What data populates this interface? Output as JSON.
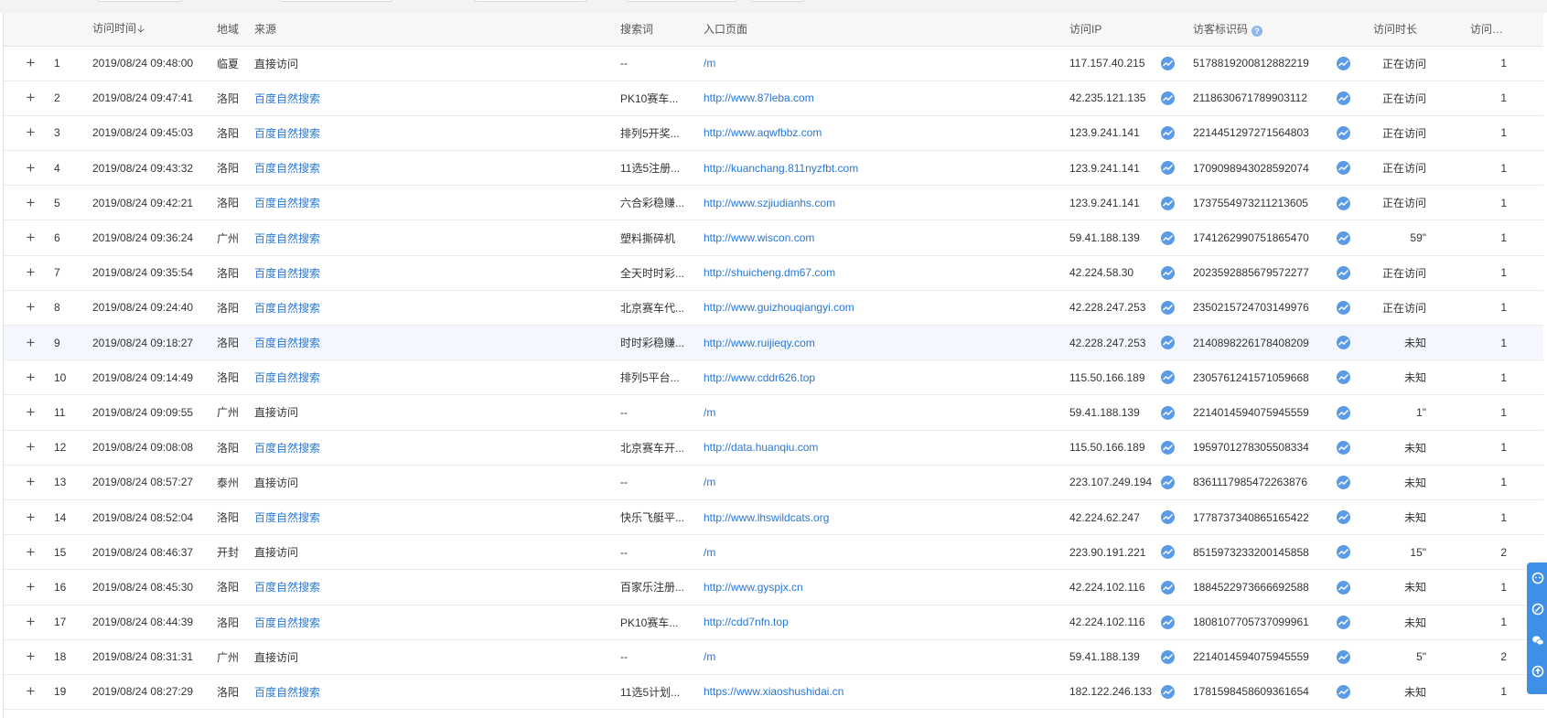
{
  "columns": {
    "visit_time": "访问时间",
    "region": "地域",
    "source": "来源",
    "keyword": "搜索词",
    "entry_page": "入口页面",
    "ip": "访问IP",
    "visitor_id": "访客标识码",
    "duration": "访问时长",
    "pages": "访问页数"
  },
  "icons": {
    "sort": "sort-down-arrow-icon",
    "help": "help-icon",
    "trend": "trend-chart-icon",
    "expand": "plus-icon"
  },
  "colors": {
    "link": "#2a77d6",
    "icon_blue": "#5b9ae6",
    "float_bar": "#3f8fe6",
    "header_bg": "#f7f7f7",
    "highlight_row": "#f4f8fe"
  },
  "rows": [
    {
      "n": "1",
      "time": "2019/08/24 09:48:00",
      "region": "临夏",
      "source": "直接访问",
      "keyword": "--",
      "entry": "/m",
      "ip": "117.157.40.215",
      "vid": "5178819200812882219",
      "dur": "正在访问",
      "pages": "1"
    },
    {
      "n": "2",
      "time": "2019/08/24 09:47:41",
      "region": "洛阳",
      "source": "百度自然搜索",
      "keyword": "PK10赛车...",
      "entry": "http://www.87leba.com",
      "ip": "42.235.121.135",
      "vid": "2118630671789903112",
      "dur": "正在访问",
      "pages": "1"
    },
    {
      "n": "3",
      "time": "2019/08/24 09:45:03",
      "region": "洛阳",
      "source": "百度自然搜索",
      "keyword": "排列5开奖...",
      "entry": "http://www.aqwfbbz.com",
      "ip": "123.9.241.141",
      "vid": "2214451297271564803",
      "dur": "正在访问",
      "pages": "1"
    },
    {
      "n": "4",
      "time": "2019/08/24 09:43:32",
      "region": "洛阳",
      "source": "百度自然搜索",
      "keyword": "11选5注册...",
      "entry": "http://kuanchang.811nyzfbt.com",
      "ip": "123.9.241.141",
      "vid": "1709098943028592074",
      "dur": "正在访问",
      "pages": "1"
    },
    {
      "n": "5",
      "time": "2019/08/24 09:42:21",
      "region": "洛阳",
      "source": "百度自然搜索",
      "keyword": "六合彩稳赚...",
      "entry": "http://www.szjiudianhs.com",
      "ip": "123.9.241.141",
      "vid": "1737554973211213605",
      "dur": "正在访问",
      "pages": "1"
    },
    {
      "n": "6",
      "time": "2019/08/24 09:36:24",
      "region": "广州",
      "source": "百度自然搜索",
      "keyword": "塑料撕碎机",
      "entry": "http://www.wiscon.com",
      "ip": "59.41.188.139",
      "vid": "1741262990751865470",
      "dur": "59\"",
      "pages": "1"
    },
    {
      "n": "7",
      "time": "2019/08/24 09:35:54",
      "region": "洛阳",
      "source": "百度自然搜索",
      "keyword": "全天时时彩...",
      "entry": "http://shuicheng.dm67.com",
      "ip": "42.224.58.30",
      "vid": "2023592885679572277",
      "dur": "正在访问",
      "pages": "1"
    },
    {
      "n": "8",
      "time": "2019/08/24 09:24:40",
      "region": "洛阳",
      "source": "百度自然搜索",
      "keyword": "北京赛车代...",
      "entry": "http://www.guizhouqiangyi.com",
      "ip": "42.228.247.253",
      "vid": "2350215724703149976",
      "dur": "正在访问",
      "pages": "1"
    },
    {
      "n": "9",
      "time": "2019/08/24 09:18:27",
      "region": "洛阳",
      "source": "百度自然搜索",
      "keyword": "时时彩稳赚...",
      "entry": "http://www.ruijieqy.com",
      "ip": "42.228.247.253",
      "vid": "2140898226178408209",
      "dur": "未知",
      "pages": "1"
    },
    {
      "n": "10",
      "time": "2019/08/24 09:14:49",
      "region": "洛阳",
      "source": "百度自然搜索",
      "keyword": "排列5平台...",
      "entry": "http://www.cddr626.top",
      "ip": "115.50.166.189",
      "vid": "2305761241571059668",
      "dur": "未知",
      "pages": "1"
    },
    {
      "n": "11",
      "time": "2019/08/24 09:09:55",
      "region": "广州",
      "source": "直接访问",
      "keyword": "--",
      "entry": "/m",
      "ip": "59.41.188.139",
      "vid": "2214014594075945559",
      "dur": "1\"",
      "pages": "1"
    },
    {
      "n": "12",
      "time": "2019/08/24 09:08:08",
      "region": "洛阳",
      "source": "百度自然搜索",
      "keyword": "北京赛车开...",
      "entry": "http://data.huanqiu.com",
      "ip": "115.50.166.189",
      "vid": "1959701278305508334",
      "dur": "未知",
      "pages": "1"
    },
    {
      "n": "13",
      "time": "2019/08/24 08:57:27",
      "region": "泰州",
      "source": "直接访问",
      "keyword": "--",
      "entry": "/m",
      "ip": "223.107.249.194",
      "vid": "8361117985472263876",
      "dur": "未知",
      "pages": "1"
    },
    {
      "n": "14",
      "time": "2019/08/24 08:52:04",
      "region": "洛阳",
      "source": "百度自然搜索",
      "keyword": "快乐飞艇平...",
      "entry": "http://www.lhswildcats.org",
      "ip": "42.224.62.247",
      "vid": "1778737340865165422",
      "dur": "未知",
      "pages": "1"
    },
    {
      "n": "15",
      "time": "2019/08/24 08:46:37",
      "region": "开封",
      "source": "直接访问",
      "keyword": "--",
      "entry": "/m",
      "ip": "223.90.191.221",
      "vid": "8515973233200145858",
      "dur": "15\"",
      "pages": "2"
    },
    {
      "n": "16",
      "time": "2019/08/24 08:45:30",
      "region": "洛阳",
      "source": "百度自然搜索",
      "keyword": "百家乐注册...",
      "entry": "http://www.gyspjx.cn",
      "ip": "42.224.102.116",
      "vid": "1884522973666692588",
      "dur": "未知",
      "pages": "1"
    },
    {
      "n": "17",
      "time": "2019/08/24 08:44:39",
      "region": "洛阳",
      "source": "百度自然搜索",
      "keyword": "PK10赛车...",
      "entry": "http://cdd7nfn.top",
      "ip": "42.224.102.116",
      "vid": "1808107705737099961",
      "dur": "未知",
      "pages": "1"
    },
    {
      "n": "18",
      "time": "2019/08/24 08:31:31",
      "region": "广州",
      "source": "直接访问",
      "keyword": "--",
      "entry": "/m",
      "ip": "59.41.188.139",
      "vid": "2214014594075945559",
      "dur": "5\"",
      "pages": "2"
    },
    {
      "n": "19",
      "time": "2019/08/24 08:27:29",
      "region": "洛阳",
      "source": "百度自然搜索",
      "keyword": "11选5计划...",
      "entry": "https://www.xiaoshushidai.cn",
      "ip": "182.122.246.133",
      "vid": "1781598458609361654",
      "dur": "未知",
      "pages": "1"
    }
  ],
  "highlighted_row": "9",
  "float_toolbar": [
    "chat-icon",
    "edit-icon",
    "wechat-icon",
    "back-to-top-icon"
  ]
}
